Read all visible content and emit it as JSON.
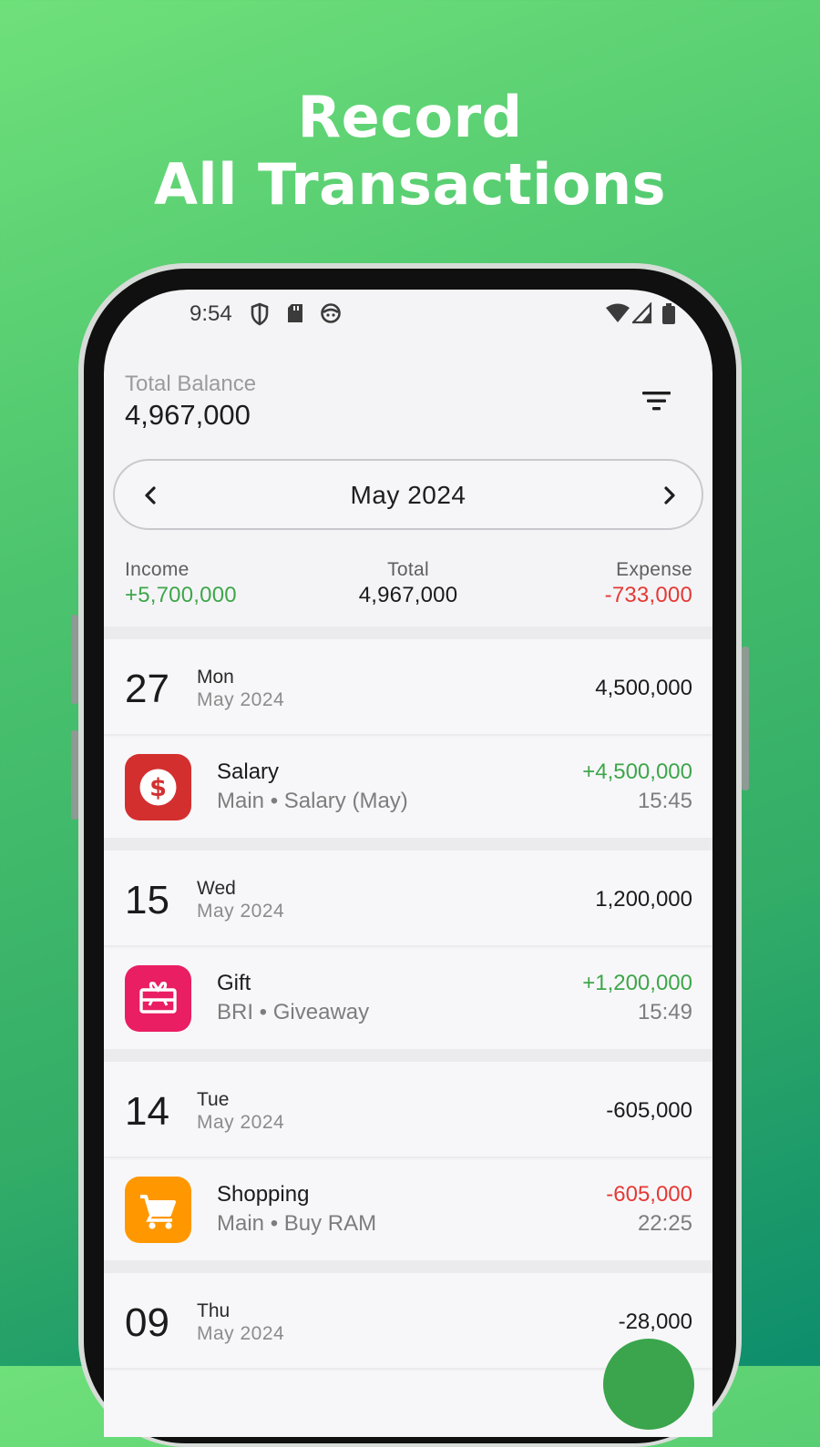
{
  "headline": {
    "line1": "Record",
    "line2": "All Transactions"
  },
  "colors": {
    "income": "#3ea64a",
    "expense": "#e53935",
    "salary_icon_bg": "#d32f2f",
    "gift_icon_bg": "#e91e63",
    "shopping_icon_bg": "#ff9800",
    "fab": "#3aa54c"
  },
  "status_bar": {
    "time": "9:54",
    "icons": [
      "shield-icon",
      "sd-card-icon",
      "face-icon",
      "wifi-icon",
      "signal-icon",
      "battery-icon"
    ]
  },
  "header": {
    "balance_label": "Total Balance",
    "balance_value": "4,967,000",
    "filter_icon": "filter-icon"
  },
  "month_selector": {
    "label": "May 2024",
    "prev_icon": "chevron-left-icon",
    "next_icon": "chevron-right-icon"
  },
  "summary": {
    "income_label": "Income",
    "income_value": "+5,700,000",
    "total_label": "Total",
    "total_value": "4,967,000",
    "expense_label": "Expense",
    "expense_value": "-733,000"
  },
  "days": [
    {
      "day": "27",
      "weekday": "Mon",
      "month": "May 2024",
      "total": "4,500,000",
      "transactions": [
        {
          "title": "Salary",
          "subtitle": "Main • Salary (May)",
          "amount": "+4,500,000",
          "time": "15:45",
          "icon": "dollar-icon",
          "type": "income"
        }
      ]
    },
    {
      "day": "15",
      "weekday": "Wed",
      "month": "May 2024",
      "total": "1,200,000",
      "transactions": [
        {
          "title": "Gift",
          "subtitle": "BRI • Giveaway",
          "amount": "+1,200,000",
          "time": "15:49",
          "icon": "gift-card-icon",
          "type": "income"
        }
      ]
    },
    {
      "day": "14",
      "weekday": "Tue",
      "month": "May 2024",
      "total": "-605,000",
      "transactions": [
        {
          "title": "Shopping",
          "subtitle": "Main • Buy RAM",
          "amount": "-605,000",
          "time": "22:25",
          "icon": "cart-icon",
          "type": "expense"
        }
      ]
    },
    {
      "day": "09",
      "weekday": "Thu",
      "month": "May 2024",
      "total": "-28,000",
      "transactions": []
    }
  ]
}
